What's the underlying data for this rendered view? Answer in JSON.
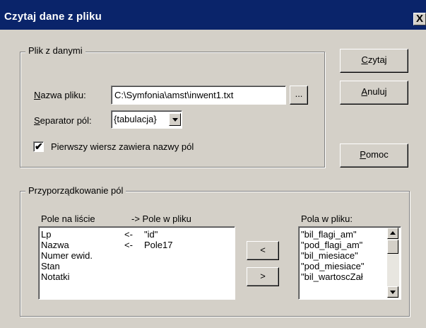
{
  "title": "Czytaj dane z pliku",
  "close_glyph": "X",
  "group_file": {
    "legend": "Plik z danymi",
    "filename_label_accel": "N",
    "filename_label_rest": "azwa pliku:",
    "filename_value": "C:\\Symfonia\\amst\\inwent1.txt",
    "browse_label": "...",
    "separator_label_accel": "S",
    "separator_label_rest": "eparator pól:",
    "separator_value": "{tabulacja}",
    "checkbox_checked": true,
    "checkbox_label": "Pierwszy wiersz zawiera nazwy pól"
  },
  "buttons": {
    "read_accel": "C",
    "read_rest": "zytaj",
    "cancel_accel": "A",
    "cancel_rest": "nuluj",
    "help_accel": "P",
    "help_rest": "omoc",
    "left_arrow": "<",
    "right_arrow": ">"
  },
  "group_mapping": {
    "legend": "Przyporządkowanie pól",
    "col_header_list": "Pole na liście",
    "col_header_file": "-> Pole w pliku",
    "fields_header": "Pola w pliku:",
    "mapping_rows": [
      {
        "field": "Lp",
        "arrow": "<-",
        "file_field": "\"id\""
      },
      {
        "field": "Nazwa",
        "arrow": "<-",
        "file_field": "Pole17"
      },
      {
        "field": "Numer ewid.",
        "arrow": "",
        "file_field": ""
      },
      {
        "field": "Stan",
        "arrow": "",
        "file_field": ""
      },
      {
        "field": "Notatki",
        "arrow": "",
        "file_field": ""
      }
    ],
    "file_fields": [
      "\"bil_flagi_am\"",
      "\"pod_flagi_am\"",
      "\"bil_miesiace\"",
      "\"pod_miesiace\"",
      "\"bil_wartoscZał"
    ]
  }
}
